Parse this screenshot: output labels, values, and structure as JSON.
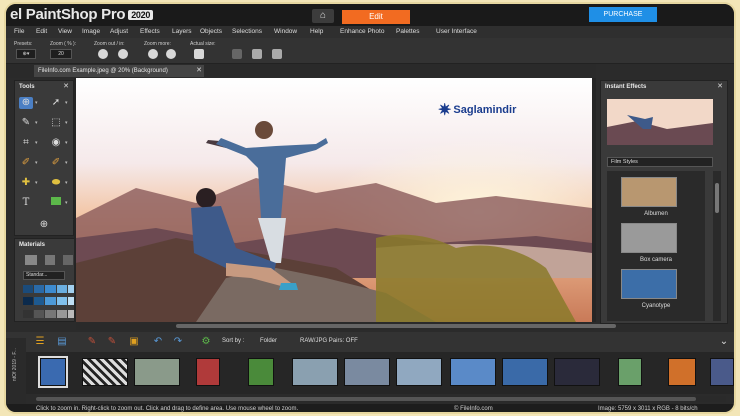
{
  "app": {
    "title": "el PaintShop Pro",
    "version": "2020",
    "mode_tab": "Edit",
    "purchase_label": "PURCHASE"
  },
  "menu": [
    "File",
    "Edit",
    "View",
    "Image",
    "Adjust",
    "Effects",
    "Layers",
    "Objects",
    "Selections",
    "Window",
    "Help",
    "Enhance Photo",
    "Palettes",
    "User Interface"
  ],
  "options": {
    "presets_label": "Presets:",
    "zoom_label": "Zoom ( % ):",
    "zoom_value": "20",
    "zoom_out_in_label": "Zoom out / in:",
    "zoom_more_label": "Zoom more:",
    "actual_size_label": "Actual size:"
  },
  "document": {
    "tab_title": "FileInfo.com Example.jpeg @ 20% (Background)"
  },
  "panels": {
    "tools_title": "Tools",
    "materials_title": "Materials",
    "materials_style": "Standar..."
  },
  "canvas": {
    "watermark": "Saglamindir"
  },
  "effects": {
    "title": "Instant Effects",
    "category": "Film Styles",
    "items": [
      {
        "label": "Albumen",
        "color": "#b89770"
      },
      {
        "label": "Box camera",
        "color": "#9a9a9a"
      },
      {
        "label": "Cyanotype",
        "color": "#3c6ea8"
      }
    ]
  },
  "organizer": {
    "sort_label": "Sort by :",
    "sort_value": "Folder",
    "raw_pairs": "RAW/JPG Pairs: OFF",
    "side_label": "ntOf 2019 - F..."
  },
  "status": {
    "hint": "Click to zoom in. Right-click to zoom out. Click and drag to define area. Use mouse wheel to zoom.",
    "credit": "© FileInfo.com",
    "image_info": "Image:  5759 x 3011 x RGB - 8 bits/ch"
  }
}
